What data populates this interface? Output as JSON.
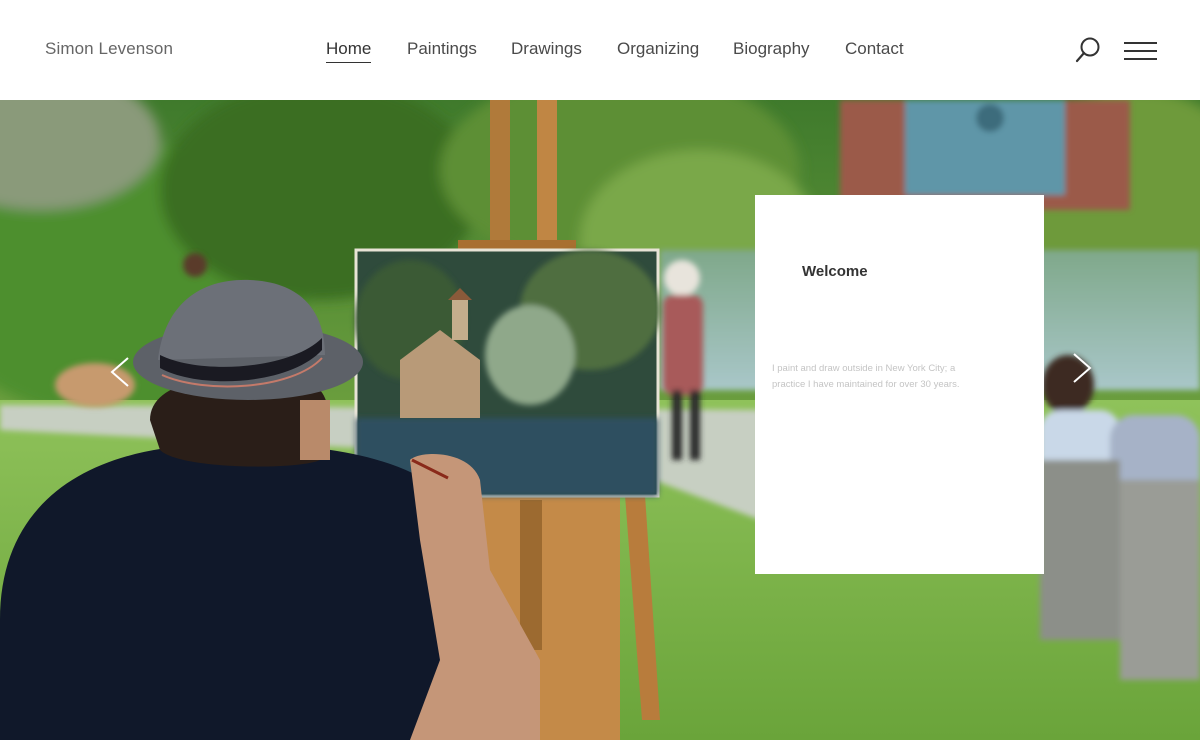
{
  "site": {
    "logo": "Simon Levenson"
  },
  "nav": {
    "items": [
      {
        "label": "Home",
        "active": true
      },
      {
        "label": "Paintings",
        "active": false
      },
      {
        "label": "Drawings",
        "active": false
      },
      {
        "label": "Organizing",
        "active": false
      },
      {
        "label": "Biography",
        "active": false
      },
      {
        "label": "Contact",
        "active": false
      }
    ]
  },
  "header": {
    "search_icon": "search-icon",
    "menu_icon": "hamburger-menu-icon"
  },
  "hero": {
    "prev_icon": "chevron-left-icon",
    "next_icon": "chevron-right-icon",
    "card": {
      "title": "Welcome",
      "text": "I paint and draw outside in New York City; a practice I have maintained for over 30 years."
    }
  },
  "colors": {
    "header_bg": "#ffffff",
    "text_dark": "#333333",
    "card_text": "#c4c4c4",
    "grass": "#7fb548",
    "foliage": "#4f8a2e"
  }
}
